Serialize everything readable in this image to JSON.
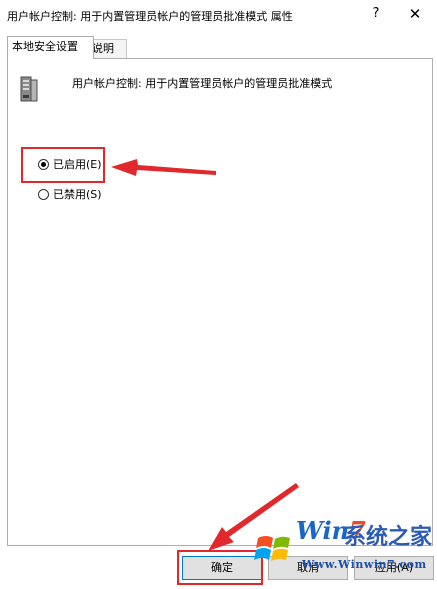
{
  "window": {
    "title": "用户帐户控制: 用于内置管理员帐户的管理员批准模式 属性",
    "help_label": "?",
    "close_label": "✕"
  },
  "tabs": [
    {
      "label": "本地安全设置",
      "active": true
    },
    {
      "label": "说明",
      "active": false
    }
  ],
  "policy": {
    "icon": "server-icon",
    "description": "用户帐户控制: 用于内置管理员帐户的管理员批准模式"
  },
  "options": [
    {
      "label": "已启用(E)",
      "checked": true
    },
    {
      "label": "已禁用(S)",
      "checked": false
    }
  ],
  "buttons": {
    "ok": "确定",
    "cancel": "取消",
    "apply": "应用(A)"
  },
  "watermark": {
    "brand_prefix": "Win",
    "brand_seven": "7",
    "brand_cn": "系统之家",
    "url": "Www.Winwin7.com"
  },
  "annotation_color": "#e0282d"
}
